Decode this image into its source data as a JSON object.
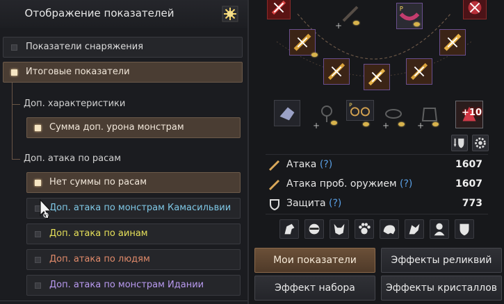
{
  "left": {
    "title": "Отображение показателей",
    "rows": {
      "equipment": "Показатели снаряжения",
      "total": "Итоговые показатели",
      "extra_dmg_sum": "Сумма доп. урона монстрам",
      "no_race_sum": "Нет суммы по расам",
      "kamasylvia": "Доп. атака по монстрам Камасильвии",
      "ain": "Доп. атака по аинам",
      "humans": "Доп. атака по людям",
      "edania": "Доп. атака по монстрам Идании"
    },
    "sections": {
      "extra_stats": "Доп. характеристики",
      "race_attack": "Доп. атака по расам"
    }
  },
  "right": {
    "stats": [
      {
        "name": "Атака",
        "q": "(?)",
        "value": "1607"
      },
      {
        "name": "Атака проб. оружием",
        "q": "(?)",
        "value": "1607"
      },
      {
        "name": "Защита",
        "q": "(?)",
        "value": "773"
      }
    ],
    "enhance_badge": "+10",
    "p_badge": "P",
    "buttons": {
      "my_stats": "Мои показатели",
      "relic_effects": "Эффекты реликвий",
      "set_effect": "Эффект набора",
      "crystal_effects": "Эффекты кристаллов"
    }
  },
  "colors": {
    "kamasylvia": "#7fc8e6",
    "ain": "#e6e05a",
    "humans": "#e08a6a",
    "edania": "#b99af0"
  }
}
